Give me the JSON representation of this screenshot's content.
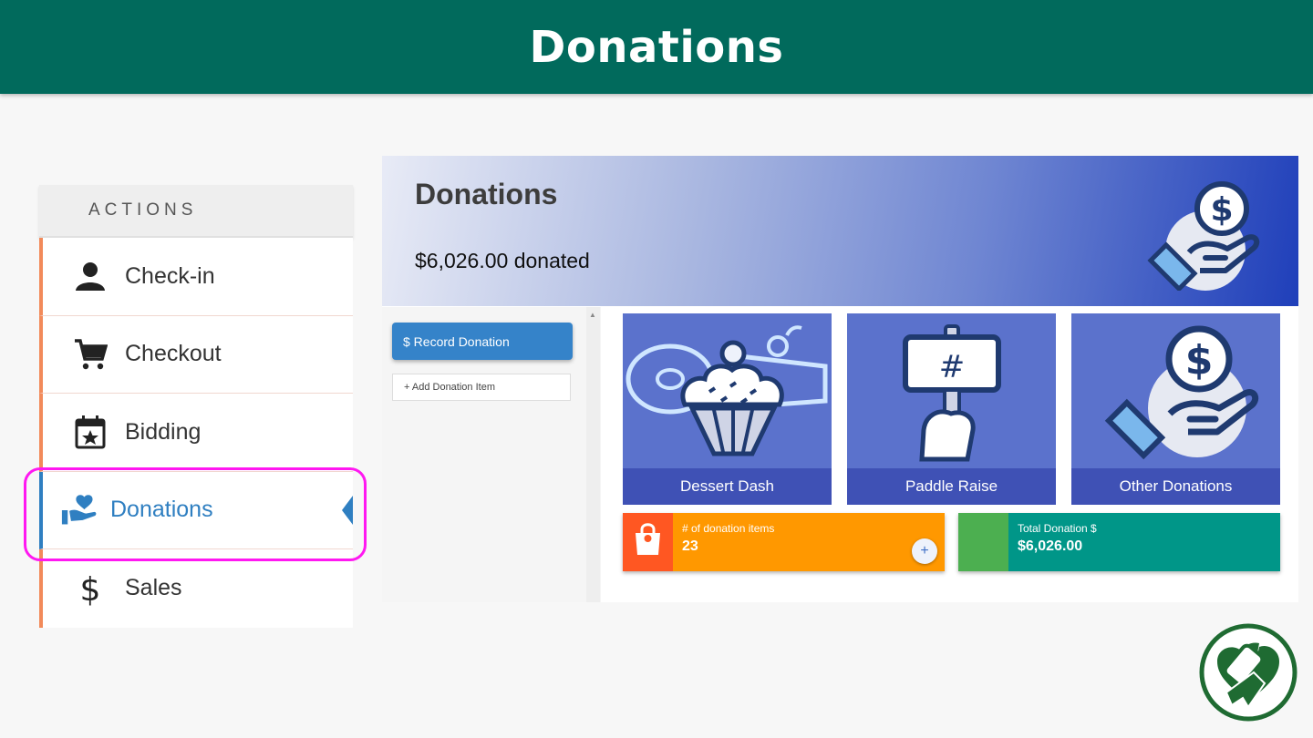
{
  "page": {
    "title": "Donations"
  },
  "sidebar": {
    "header": "ACTIONS",
    "items": [
      {
        "label": "Check-in",
        "icon": "person-icon"
      },
      {
        "label": "Checkout",
        "icon": "cart-icon"
      },
      {
        "label": "Bidding",
        "icon": "calendar-star-icon"
      },
      {
        "label": "Donations",
        "icon": "donation-hand-icon",
        "active": true
      },
      {
        "label": "Sales",
        "icon": "dollar-icon"
      }
    ]
  },
  "panel": {
    "title": "Donations",
    "summary": "$6,026.00 donated",
    "record_button": "$  Record Donation",
    "add_item": "+  Add Donation Item",
    "tiles": [
      {
        "label": "Dessert Dash",
        "icon": "cupcake-icon"
      },
      {
        "label": "Paddle Raise",
        "icon": "paddle-icon"
      },
      {
        "label": "Other Donations",
        "icon": "hand-dollar-icon"
      }
    ],
    "stats": [
      {
        "label": "# of donation items",
        "value": "23",
        "icon": "bag-icon",
        "colors": {
          "side": "#ff5722",
          "main": "#ff9800"
        }
      },
      {
        "label": "Total Donation $",
        "value": "$6,026.00",
        "colors": {
          "side": "#4caf50",
          "main": "#009688"
        }
      }
    ]
  },
  "colors": {
    "topbar": "#016a5c",
    "highlight": "#ff18f1",
    "accent": "#2f7fc1"
  }
}
